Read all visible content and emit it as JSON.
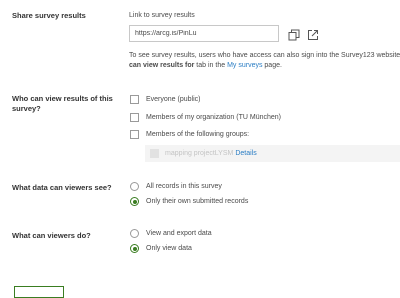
{
  "share": {
    "label": "Share survey results",
    "link_heading": "Link to survey results",
    "url": "https://arcg.is/PinLu",
    "desc_line1": "To see survey results, users who have access can also sign into the Survey123 website",
    "desc_bold": "can view results for",
    "desc_mid": " tab in the ",
    "desc_link": "My surveys",
    "desc_end": " page."
  },
  "who_view": {
    "label_line1": "Who can view results of this",
    "label_line2": "survey?",
    "options": [
      {
        "label": "Everyone (public)",
        "checked": false
      },
      {
        "label": "Members of my organization (TU München)",
        "checked": false
      },
      {
        "label": "Members of the following groups:",
        "checked": false
      }
    ],
    "group": {
      "name": "mapping projectLYSM",
      "details": "Details"
    }
  },
  "what_see": {
    "label": "What data can viewers see?",
    "options": [
      {
        "label": "All records in this survey",
        "selected": false
      },
      {
        "label": "Only their own submitted records",
        "selected": true
      }
    ]
  },
  "what_do": {
    "label": "What can viewers do?",
    "options": [
      {
        "label": "View and export data",
        "selected": false
      },
      {
        "label": "Only view data",
        "selected": true
      }
    ]
  },
  "colors": {
    "accent": "#3a7d21",
    "link": "#2a7dc4"
  },
  "icons": {
    "copy": "copy-icon",
    "open": "open-external-icon"
  }
}
